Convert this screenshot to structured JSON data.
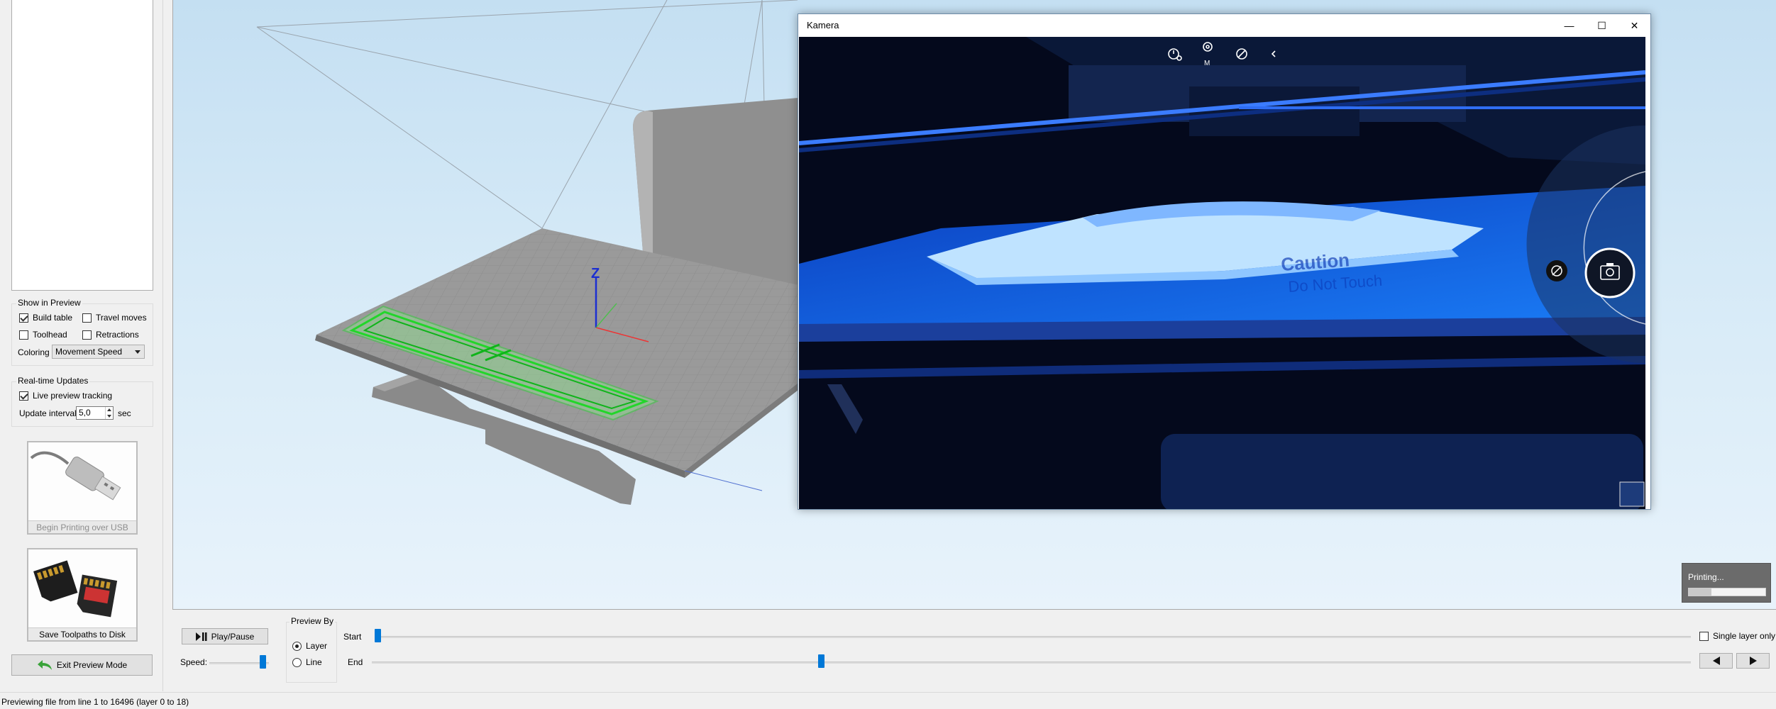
{
  "left_panel": {
    "show_in_preview": {
      "title": "Show in Preview",
      "build_table": {
        "label": "Build table",
        "checked": true
      },
      "travel_moves": {
        "label": "Travel moves",
        "checked": false
      },
      "toolhead": {
        "label": "Toolhead",
        "checked": false
      },
      "retractions": {
        "label": "Retractions",
        "checked": false
      },
      "coloring_label": "Coloring",
      "coloring_value": "Movement Speed"
    },
    "realtime_updates": {
      "title": "Real-time Updates",
      "live_preview": {
        "label": "Live preview tracking",
        "checked": true
      },
      "update_interval_label": "Update interval",
      "update_interval_value": "5,0",
      "update_interval_unit": "sec"
    },
    "usb_button": {
      "label": "Begin Printing over USB",
      "icon": "usb-cable-icon",
      "enabled": false
    },
    "sd_button": {
      "label": "Save Toolpaths to Disk",
      "icon": "sd-card-icon"
    },
    "exit_button": {
      "label": "Exit Preview Mode",
      "icon": "green-back-arrow-icon"
    }
  },
  "viewport": {
    "axis_label": "Z",
    "colors": {
      "toolpath": "#22d62a",
      "bed": "#9a9a9a",
      "z_axis": "#1c2fd1",
      "x_axis": "#e33",
      "y_axis": "#3c3"
    }
  },
  "camera_window": {
    "title": "Kamera",
    "controls": {
      "minimize": "—",
      "maximize": "☐",
      "close": "✕"
    },
    "overlay_icons": [
      "timer-icon",
      "exposure-icon",
      "hdr-off-icon",
      "collapse-icon"
    ],
    "overlay_mode": "M",
    "shutter_icon": "camera-icon",
    "side_icon": "video-off-icon",
    "bed_text": [
      "Caution",
      "Do Not Touch"
    ]
  },
  "bottom_controls": {
    "play_pause": {
      "label": "Play/Pause",
      "icon": "play-pause-icon"
    },
    "speed_label": "Speed:",
    "preview_by": {
      "title": "Preview By",
      "options": [
        "Layer",
        "Line"
      ],
      "selected": "Layer"
    },
    "start_label": "Start",
    "end_label": "End",
    "single_layer": {
      "label": "Single layer only",
      "checked": false
    },
    "prev_icon": "triangle-left-icon",
    "next_icon": "triangle-right-icon",
    "start_position": 0.0,
    "end_position": 0.34,
    "speed_position": 0.95
  },
  "printing_toast": {
    "label": "Printing...",
    "progress": 0.3
  },
  "status_bar": {
    "text": "Previewing file from line 1 to 16496 (layer 0 to 18)"
  }
}
